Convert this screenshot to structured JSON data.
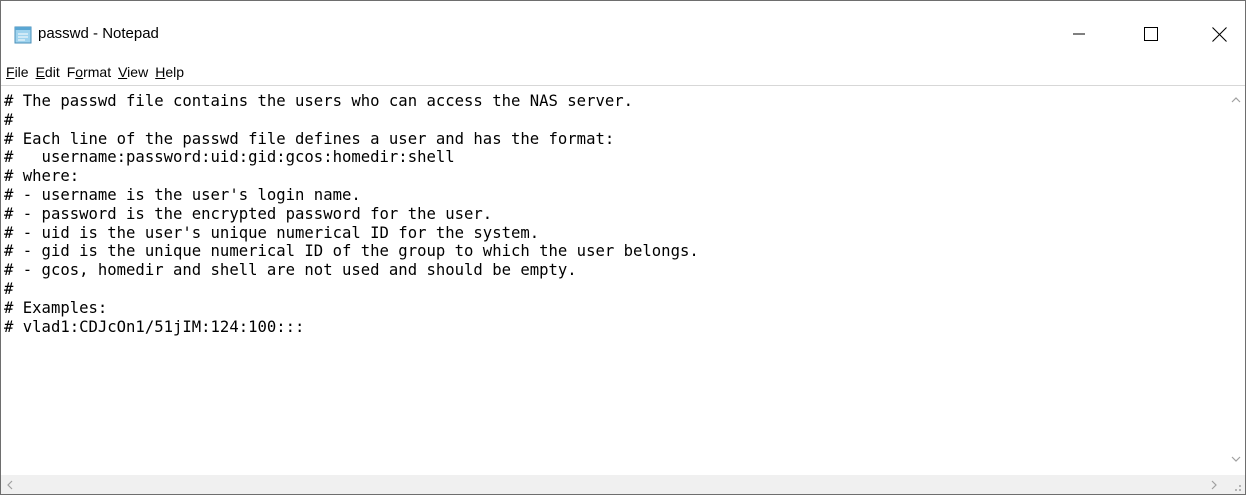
{
  "window": {
    "title": "passwd - Notepad",
    "controls": {
      "minimize_icon": "minimize-icon",
      "maximize_icon": "maximize-icon",
      "close_icon": "close-icon"
    }
  },
  "menu": {
    "items": [
      {
        "mnemonic": "F",
        "rest": "ile"
      },
      {
        "mnemonic": "E",
        "rest": "dit"
      },
      {
        "pre": "F",
        "mnemonic": "o",
        "rest": "rmat"
      },
      {
        "mnemonic": "V",
        "rest": "iew"
      },
      {
        "mnemonic": "H",
        "rest": "elp"
      }
    ]
  },
  "editor": {
    "lines": [
      "# The passwd file contains the users who can access the NAS server.",
      "#",
      "# Each line of the passwd file defines a user and has the format:",
      "#   username:password:uid:gid:gcos:homedir:shell",
      "# where:",
      "# - username is the user's login name.",
      "# - password is the encrypted password for the user.",
      "# - uid is the user's unique numerical ID for the system.",
      "# - gid is the unique numerical ID of the group to which the user belongs.",
      "# - gcos, homedir and shell are not used and should be empty.",
      "#",
      "# Examples:",
      "# vlad1:CDJcOn1/51jIM:124:100:::"
    ]
  },
  "colors": {
    "border": "#6e6e6e",
    "scroll_track": "#f0f0f0",
    "arrow": "#a0a0a0"
  }
}
